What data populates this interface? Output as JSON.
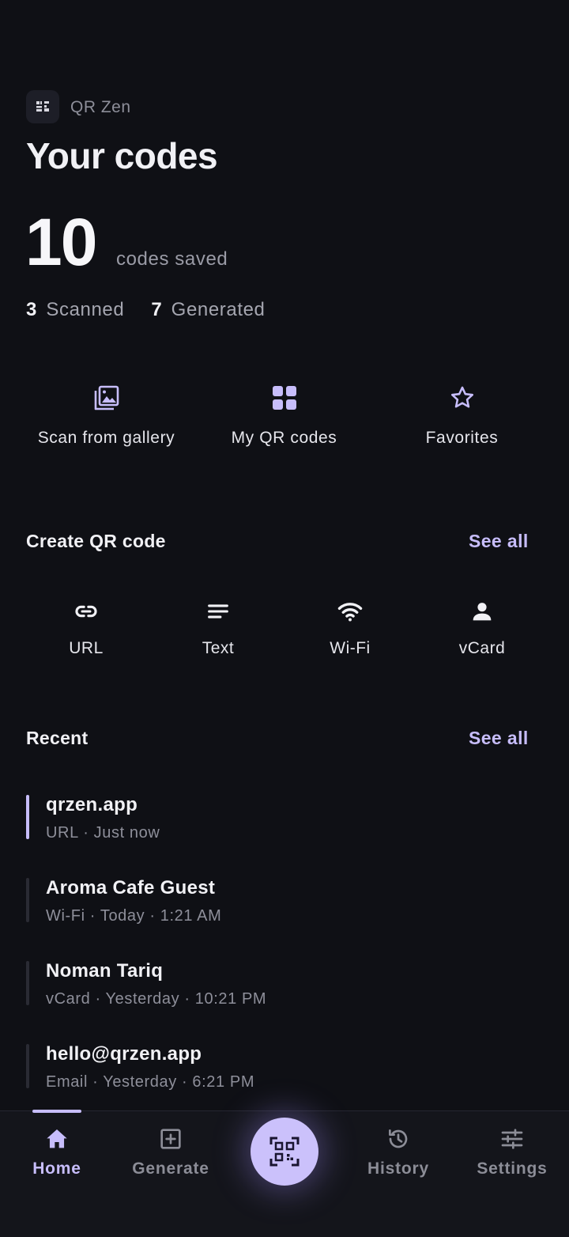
{
  "header": {
    "app_name": "QR Zen",
    "title": "Your codes"
  },
  "summary": {
    "total": "10",
    "total_label": "codes saved",
    "scanned_count": "3",
    "scanned_label": "Scanned",
    "generated_count": "7",
    "generated_label": "Generated"
  },
  "quick_actions": [
    {
      "label": "Scan from gallery",
      "icon": "gallery-icon"
    },
    {
      "label": "My QR codes",
      "icon": "grid-icon"
    },
    {
      "label": "Favorites",
      "icon": "star-icon"
    }
  ],
  "create": {
    "title": "Create QR code",
    "see_all": "See all",
    "items": [
      {
        "label": "URL",
        "icon": "link-icon"
      },
      {
        "label": "Text",
        "icon": "text-icon"
      },
      {
        "label": "Wi-Fi",
        "icon": "wifi-icon"
      },
      {
        "label": "vCard",
        "icon": "person-icon"
      }
    ]
  },
  "recent": {
    "title": "Recent",
    "see_all": "See all",
    "items": [
      {
        "title": "qrzen.app",
        "subtitle": "URL · Just now"
      },
      {
        "title": "Aroma Cafe Guest",
        "subtitle": "Wi-Fi · Today · 1:21 AM"
      },
      {
        "title": "Noman Tariq",
        "subtitle": "vCard · Yesterday · 10:21 PM"
      },
      {
        "title": "hello@qrzen.app",
        "subtitle": "Email · Yesterday · 6:21 PM"
      }
    ]
  },
  "nav": {
    "items": [
      {
        "label": "Home",
        "icon": "home-icon"
      },
      {
        "label": "Generate",
        "icon": "plus-square-icon"
      },
      {
        "label": "History",
        "icon": "history-icon"
      },
      {
        "label": "Settings",
        "icon": "sliders-icon"
      }
    ],
    "scan_icon": "qr-scan-icon"
  },
  "colors": {
    "background": "#0f1015",
    "accent": "#c7bdfb",
    "text_primary": "#f1f1f5",
    "text_secondary": "#8e8f9a"
  }
}
